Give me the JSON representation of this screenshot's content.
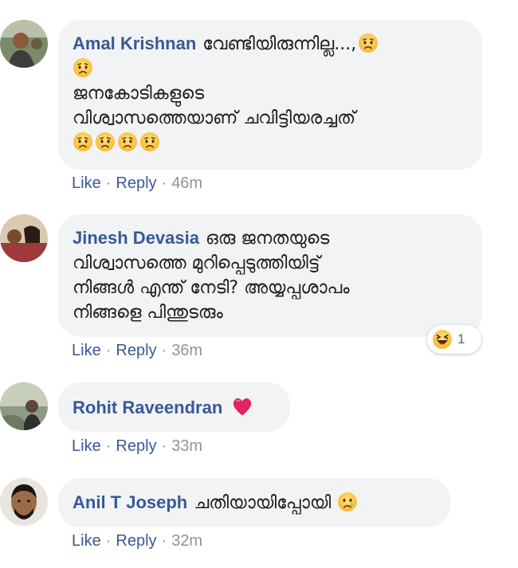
{
  "comments": [
    {
      "author": "Amal Krishnan",
      "text": "വേണ്ടിയിരുന്നില്ല...,",
      "line2": "",
      "line3": "ജനകോടികളുടെ",
      "line4": "വിശ്വാസത്തെയാണ് ചവിട്ടിയരച്ചത്",
      "actions": {
        "like": "Like",
        "reply": "Reply",
        "time": "46m"
      }
    },
    {
      "author": "Jinesh Devasia",
      "text": "ഒരു ജനതയുടെ",
      "line2": "വിശ്വാസത്തെ മുറിപ്പെടുത്തിയിട്ട്",
      "line3": "നിങ്ങൾ എന്ത് നേടി? അയ്യപ്പശാപം",
      "line4": "നിങ്ങളെ പിന്തുടരും",
      "reaction_count": "1",
      "actions": {
        "like": "Like",
        "reply": "Reply",
        "time": "36m"
      }
    },
    {
      "author": "Rohit Raveendran",
      "actions": {
        "like": "Like",
        "reply": "Reply",
        "time": "33m"
      }
    },
    {
      "author": "Anil T Joseph",
      "text": "ചതിയായിപ്പോയി",
      "actions": {
        "like": "Like",
        "reply": "Reply",
        "time": "32m"
      }
    }
  ],
  "icons": {
    "sad": "sad-emoji-icon",
    "haha": "haha-reaction-icon",
    "heart": "red-heart-icon",
    "cry": "crying-emoji-icon"
  },
  "colors": {
    "author": "#385898",
    "bubble": "#f2f3f5",
    "meta": "#90949c"
  }
}
